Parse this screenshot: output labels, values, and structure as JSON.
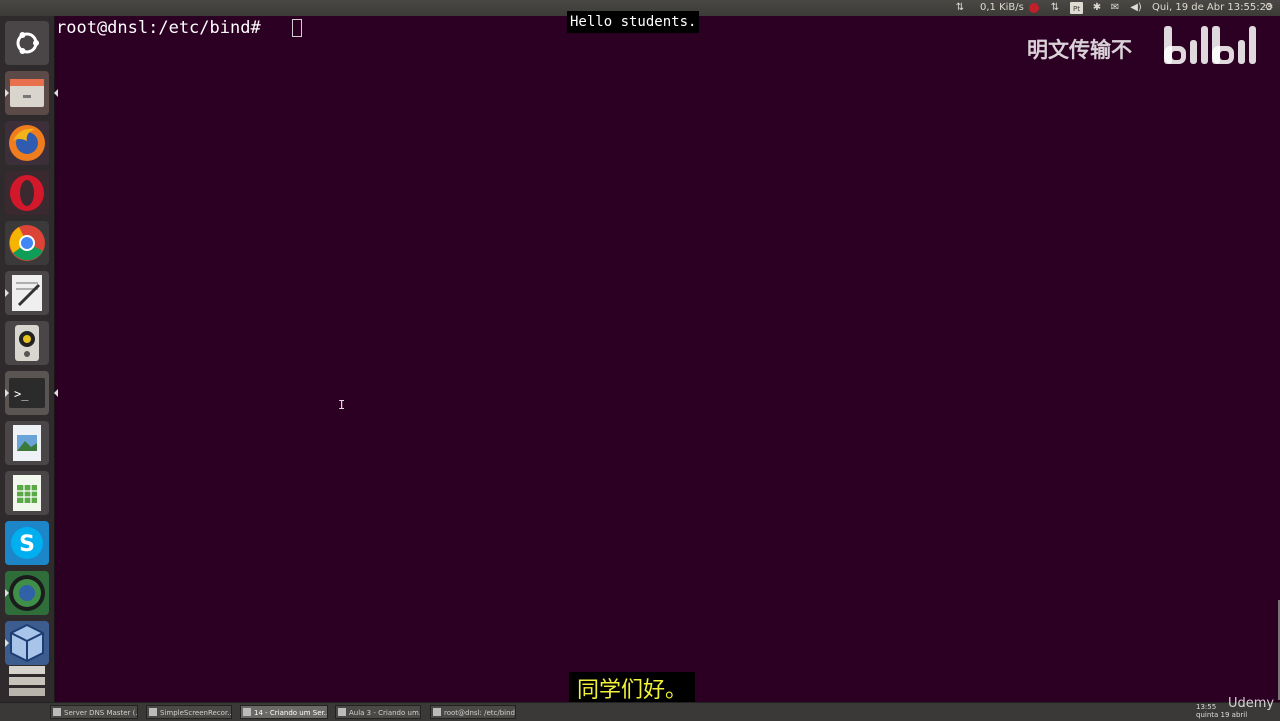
{
  "terminal": {
    "prompt": "root@dnsl:/etc/bind#"
  },
  "subtitles": {
    "english": "Hello students.",
    "chinese": "同学们好。"
  },
  "watermark": {
    "text": "明文传输不",
    "logo": "bilibili"
  },
  "top_panel": {
    "net_speed": "0,1 KiB/s",
    "datetime": "Qui, 19 de Abr 13:55:23",
    "icons": [
      "network-transfer-icon",
      "ruby-icon",
      "sync-icon",
      "pt-keyboard-icon",
      "bluetooth-icon",
      "mail-icon",
      "volume-icon",
      "gear-icon"
    ]
  },
  "launcher": {
    "items": [
      {
        "name": "ubuntu-dash",
        "icon": "ubuntu-logo-icon"
      },
      {
        "name": "files",
        "icon": "file-manager-icon"
      },
      {
        "name": "firefox",
        "icon": "firefox-icon"
      },
      {
        "name": "opera",
        "icon": "opera-icon"
      },
      {
        "name": "chrome",
        "icon": "chrome-icon"
      },
      {
        "name": "text-editor",
        "icon": "text-editor-icon"
      },
      {
        "name": "rhythmbox",
        "icon": "speaker-icon"
      },
      {
        "name": "terminal",
        "icon": "terminal-icon"
      },
      {
        "name": "image-viewer",
        "icon": "image-viewer-icon"
      },
      {
        "name": "spreadsheet",
        "icon": "spreadsheet-icon"
      },
      {
        "name": "skype",
        "icon": "skype-icon"
      },
      {
        "name": "screen-recorder",
        "icon": "globe-icon"
      },
      {
        "name": "virtualbox",
        "icon": "virtualbox-icon"
      },
      {
        "name": "workspaces",
        "icon": "workspace-icon"
      }
    ]
  },
  "taskbar": {
    "tasks": [
      {
        "label": "Server DNS Master (...",
        "active": false
      },
      {
        "label": "SimpleScreenRecor...",
        "active": false
      },
      {
        "label": "14 - Criando um Ser...",
        "active": true
      },
      {
        "label": "Aula 3 - Criando um...",
        "active": false
      },
      {
        "label": "root@dnsl: /etc/bind",
        "active": false
      }
    ],
    "clock_time": "13:55",
    "clock_date": "quinta 19 abril",
    "udemy": "Udemy"
  },
  "colors": {
    "terminal_bg": "#2c0022",
    "subtitle_cn": "#f2f23a"
  }
}
